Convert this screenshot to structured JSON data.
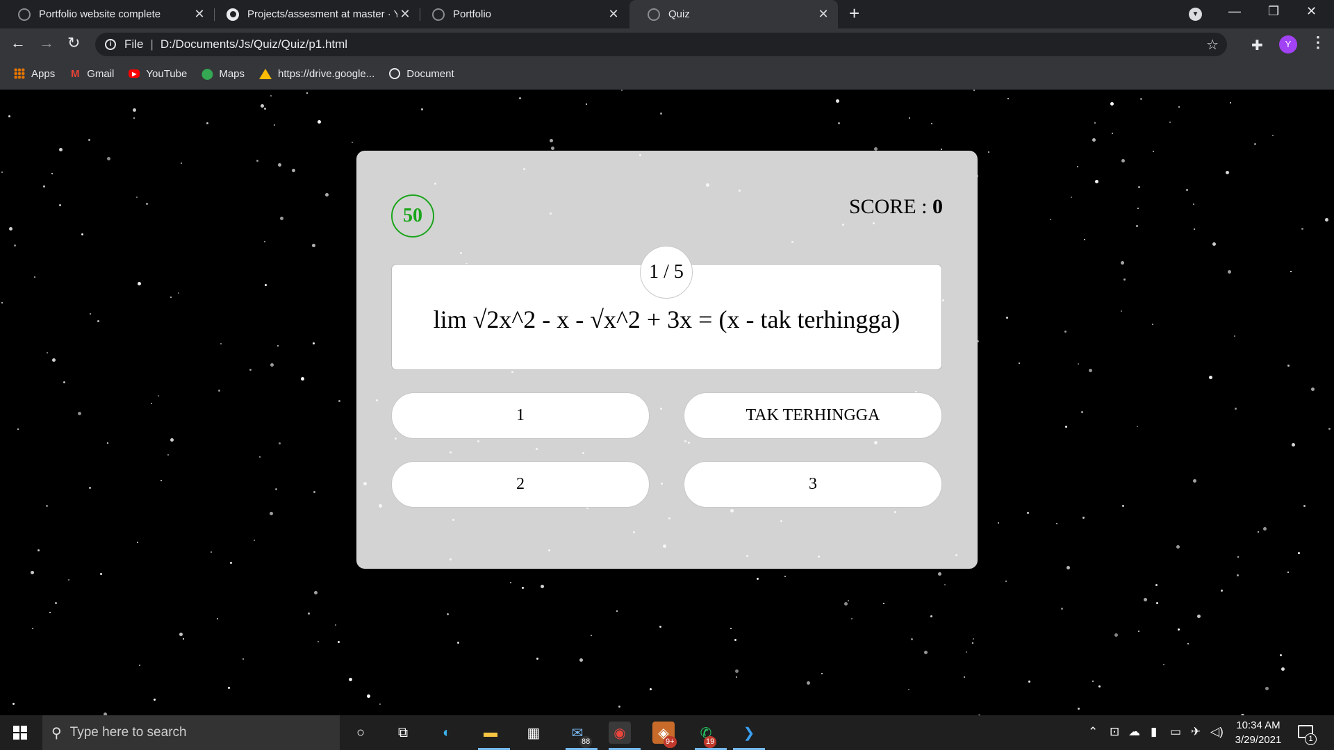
{
  "browser": {
    "tabs": [
      {
        "title": "Portfolio website complete",
        "icon": "globe-icon",
        "active": false
      },
      {
        "title": "Projects/assesment at master · Yo",
        "icon": "github-icon",
        "active": false
      },
      {
        "title": "Portfolio",
        "icon": "globe-icon",
        "active": false
      },
      {
        "title": "Quiz",
        "icon": "globe-icon",
        "active": true
      }
    ],
    "address": {
      "scheme": "File",
      "path": "D:/Documents/Js/Quiz/Quiz/p1.html"
    },
    "profile_initial": "Y",
    "bookmarks": [
      {
        "label": "Apps",
        "icon": "apps-grid-icon"
      },
      {
        "label": "Gmail",
        "icon": "gmail-icon"
      },
      {
        "label": "YouTube",
        "icon": "youtube-icon"
      },
      {
        "label": "Maps",
        "icon": "maps-pin-icon"
      },
      {
        "label": "https://drive.google...",
        "icon": "drive-icon"
      },
      {
        "label": "Document",
        "icon": "globe-icon"
      }
    ]
  },
  "quiz": {
    "timer": "50",
    "score_label": "SCORE : ",
    "score_value": "0",
    "counter": "1 / 5",
    "question": "lim √2x^2 - x - √x^2 + 3x = (x - tak terhingga)",
    "answers": [
      "1",
      "TAK TERHINGGA",
      "2",
      "3"
    ],
    "colors": {
      "card": "#d3d3d3",
      "timer": "#1aa51a",
      "background": "#000000"
    }
  },
  "taskbar": {
    "search_placeholder": "Type here to search",
    "badges": {
      "mail": "88",
      "teams": "9+",
      "whatsapp": "19"
    },
    "time": "10:34 AM",
    "date": "3/29/2021",
    "notification_count": "1"
  }
}
